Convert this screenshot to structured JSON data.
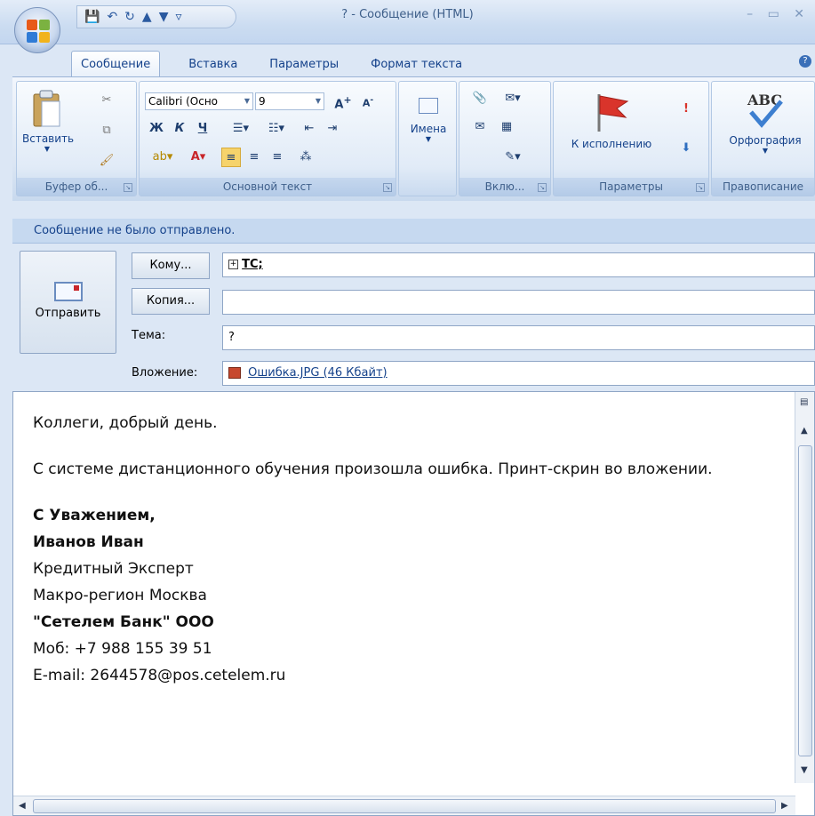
{
  "window": {
    "title": "? - Сообщение (HTML)",
    "controls": "– ▭ ✕"
  },
  "tabs": [
    "Сообщение",
    "Вставка",
    "Параметры",
    "Формат текста"
  ],
  "ribbon": {
    "clipboard": {
      "paste_label": "Вставить",
      "group_label": "Буфер об..."
    },
    "basic_text": {
      "font_name": "Calibri (Осно",
      "font_size": "9",
      "bold": "Ж",
      "italic": "К",
      "underline": "Ч",
      "group_label": "Основной текст"
    },
    "names": {
      "label": "Имена"
    },
    "include": {
      "group_label": "Вклю..."
    },
    "options": {
      "followup_label": "К исполнению",
      "group_label": "Параметры"
    },
    "proofing": {
      "spelling_label": "Орфография",
      "group_label": "Правописание"
    }
  },
  "infobar": {
    "text": "Сообщение не было отправлено."
  },
  "header": {
    "send_label": "Отправить",
    "to_label": "Кому...",
    "to_value": "TC;",
    "cc_label": "Копия...",
    "cc_value": "",
    "subject_label": "Тема:",
    "subject_value": "?",
    "attach_label": "Вложение:",
    "attach_value": "Ошибка.JPG (46 Кбайт)"
  },
  "body": {
    "greeting": "Коллеги, добрый день.",
    "message": "С системе дистанционного обучения произошла ошибка. Принт-скрин во вложении.",
    "regards": "С Уважением,",
    "name": "Иванов Иван",
    "position": "Кредитный Эксперт",
    "region": "Макро-регион Москва",
    "company": "\"Сетелем Банк\" ООО",
    "mobile": "Моб: +7 988 155 39 51",
    "email": "E-mail: 2644578@pos.cetelem.ru"
  },
  "colors": {
    "ribbon_text": "#15428b",
    "infobar_bg": "#c6d9f0",
    "flag": "#d9342b"
  }
}
